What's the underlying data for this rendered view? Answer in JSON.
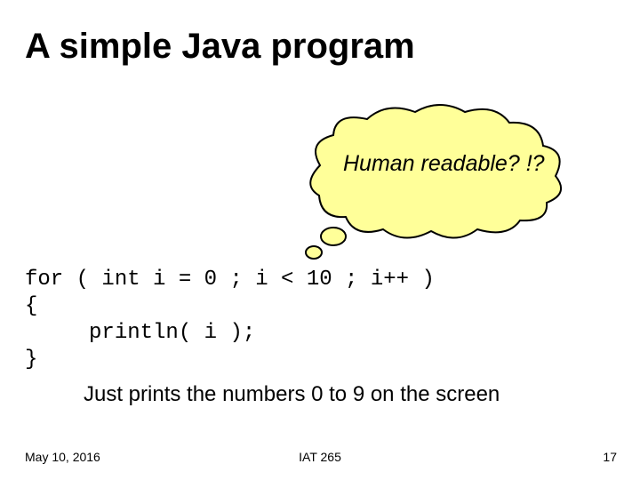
{
  "title": "A simple Java program",
  "bubble": {
    "text": "Human readable? !?"
  },
  "code": {
    "line1": "for ( int i = 0 ; i < 10 ; i++ )",
    "line2": "{",
    "line3": "     println( i );",
    "line4": "}"
  },
  "caption": "Just prints the numbers 0 to 9 on the screen",
  "footer": {
    "date": "May 10, 2016",
    "course": "IAT 265",
    "page": "17"
  },
  "colors": {
    "bubbleFill": "#FFFF99",
    "bubbleStroke": "#000000"
  }
}
